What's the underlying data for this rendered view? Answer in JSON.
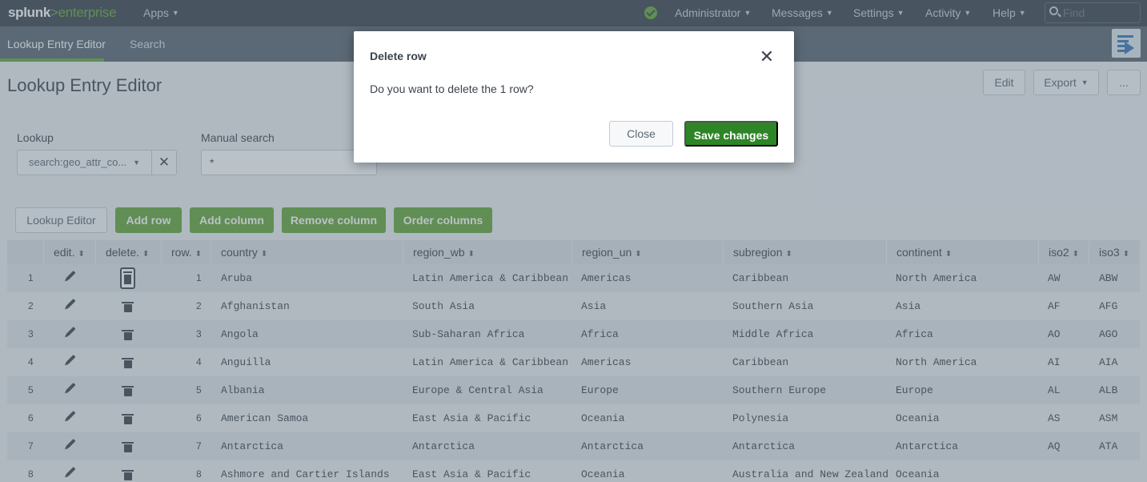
{
  "topbar": {
    "logo_primary": "splunk",
    "logo_secondary": ">enterprise",
    "apps_label": "Apps",
    "administrator_label": "Administrator",
    "messages_label": "Messages",
    "settings_label": "Settings",
    "activity_label": "Activity",
    "help_label": "Help",
    "find_placeholder": "Find",
    "status_color": "#65a637"
  },
  "appbar": {
    "tabs": [
      {
        "label": "Lookup Entry Editor",
        "active": true
      },
      {
        "label": "Search",
        "active": false
      }
    ]
  },
  "page": {
    "title": "Lookup Entry Editor",
    "edit_label": "Edit",
    "export_label": "Export",
    "more_label": "...",
    "lookup_label": "Lookup",
    "lookup_value": "search:geo_attr_co...",
    "lookup_clear": "✕",
    "manual_search_label": "Manual search",
    "manual_search_value": "*"
  },
  "toolbar": {
    "lookup_editor": "Lookup Editor",
    "add_row": "Add row",
    "add_column": "Add column",
    "remove_column": "Remove column",
    "order_columns": "Order columns"
  },
  "table": {
    "headers": [
      "edit.",
      "delete.",
      "row.",
      "country",
      "region_wb",
      "region_un",
      "subregion",
      "continent",
      "iso2",
      "iso3"
    ],
    "sort_icon": "⬍",
    "rows": [
      {
        "idx": "1",
        "row": "1",
        "country": "Aruba",
        "region_wb": "Latin America & Caribbean",
        "region_un": "Americas",
        "subregion": "Caribbean",
        "continent": "North America",
        "iso2": "AW",
        "iso3": "ABW"
      },
      {
        "idx": "2",
        "row": "2",
        "country": "Afghanistan",
        "region_wb": "South Asia",
        "region_un": "Asia",
        "subregion": "Southern Asia",
        "continent": "Asia",
        "iso2": "AF",
        "iso3": "AFG"
      },
      {
        "idx": "3",
        "row": "3",
        "country": "Angola",
        "region_wb": "Sub-Saharan Africa",
        "region_un": "Africa",
        "subregion": "Middle Africa",
        "continent": "Africa",
        "iso2": "AO",
        "iso3": "AGO"
      },
      {
        "idx": "4",
        "row": "4",
        "country": "Anguilla",
        "region_wb": "Latin America & Caribbean",
        "region_un": "Americas",
        "subregion": "Caribbean",
        "continent": "North America",
        "iso2": "AI",
        "iso3": "AIA"
      },
      {
        "idx": "5",
        "row": "5",
        "country": "Albania",
        "region_wb": "Europe & Central Asia",
        "region_un": "Europe",
        "subregion": "Southern Europe",
        "continent": "Europe",
        "iso2": "AL",
        "iso3": "ALB"
      },
      {
        "idx": "6",
        "row": "6",
        "country": "American Samoa",
        "region_wb": "East Asia & Pacific",
        "region_un": "Oceania",
        "subregion": "Polynesia",
        "continent": "Oceania",
        "iso2": "AS",
        "iso3": "ASM"
      },
      {
        "idx": "7",
        "row": "7",
        "country": "Antarctica",
        "region_wb": "Antarctica",
        "region_un": "Antarctica",
        "subregion": "Antarctica",
        "continent": "Antarctica",
        "iso2": "AQ",
        "iso3": "ATA"
      },
      {
        "idx": "8",
        "row": "8",
        "country": "Ashmore and Cartier Islands",
        "region_wb": "East Asia & Pacific",
        "region_un": "Oceania",
        "subregion": "Australia and New Zealand",
        "continent": "Oceania",
        "iso2": "",
        "iso3": ""
      }
    ]
  },
  "modal": {
    "title": "Delete row",
    "close_glyph": "✕",
    "body": "Do you want to delete the 1 row?",
    "close_label": "Close",
    "save_label": "Save changes"
  }
}
